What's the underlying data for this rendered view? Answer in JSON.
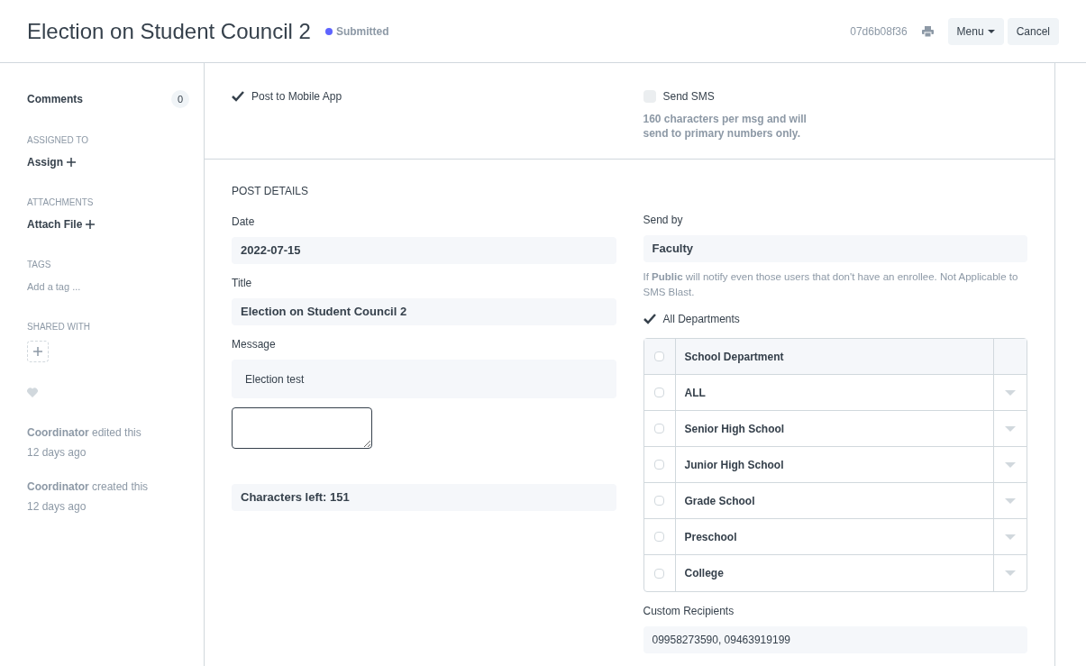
{
  "header": {
    "title": "Election on Student Council 2",
    "status": {
      "label": "Submitted",
      "color": "#5e64ff"
    },
    "doc_id": "07d6b08f36",
    "buttons": [
      {
        "label": "Menu",
        "kind": "dropdown"
      },
      {
        "label": "Cancel",
        "kind": "plain"
      }
    ]
  },
  "sidebar": {
    "comments": {
      "label": "Comments",
      "count": "0"
    },
    "sections": [
      {
        "heading": "ASSIGNED TO",
        "kind": "action",
        "text": "Assign"
      },
      {
        "heading": "ATTACHMENTS",
        "kind": "action",
        "text": "Attach File"
      },
      {
        "heading": "TAGS",
        "kind": "hint",
        "text": "Add a tag ..."
      },
      {
        "heading": "SHARED WITH",
        "kind": "share"
      }
    ],
    "liked": false,
    "activity": [
      {
        "user": "Coordinator",
        "action": "edited this",
        "time": "12 days ago"
      },
      {
        "user": "Coordinator",
        "action": "created this",
        "time": "12 days ago"
      }
    ]
  },
  "options": [
    {
      "label": "Post to Mobile App",
      "checked": true
    },
    {
      "label": "Send SMS",
      "checked": false,
      "note": "160 characters per msg and will send to primary numbers only."
    }
  ],
  "post_details": {
    "heading": "POST DETAILS",
    "date": {
      "label": "Date",
      "value": "2022-07-15"
    },
    "title": {
      "label": "Title",
      "value": "Election on Student Council 2"
    },
    "message": {
      "label": "Message",
      "value": "Election test"
    },
    "characters_left": "Characters left: 151",
    "send_by": {
      "label": "Send by",
      "value": "Faculty"
    },
    "send_by_help": "If **Public** will notify even those users that don't have an enrollee. Not Applicable to SMS Blast.",
    "all_departments": {
      "label": "All Departments",
      "checked": true
    },
    "table": {
      "header_checked": false,
      "column": "School Department",
      "rows": [
        {
          "name": "ALL",
          "checked": false
        },
        {
          "name": "Senior High School",
          "checked": false
        },
        {
          "name": "Junior High School",
          "checked": false
        },
        {
          "name": "Grade School",
          "checked": false
        },
        {
          "name": "Preschool",
          "checked": false
        },
        {
          "name": "College",
          "checked": false
        }
      ]
    },
    "custom_recipients": {
      "label": "Custom Recipients",
      "value": "09958273590, 09463919199"
    }
  }
}
